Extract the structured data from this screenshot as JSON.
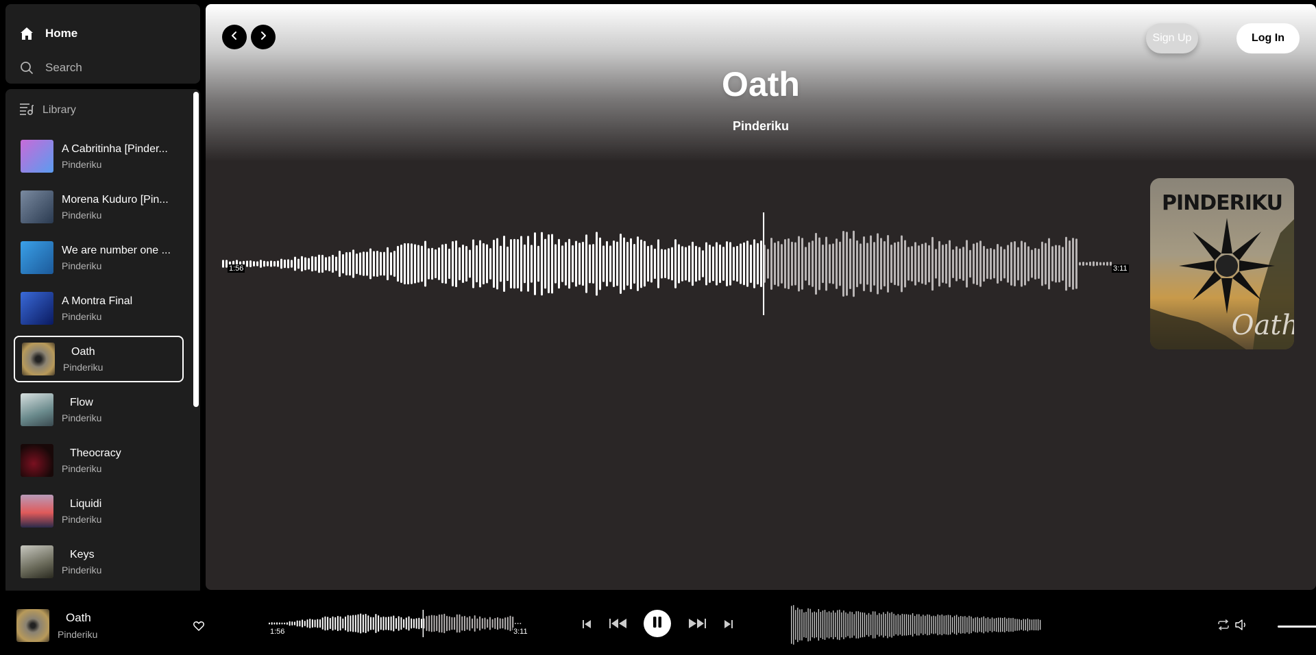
{
  "nav": {
    "home": "Home",
    "search": "Search"
  },
  "library": {
    "label": "Library",
    "tracks": [
      {
        "title": "A Cabritinha [Pinder...",
        "artist": "Pinderiku",
        "active": false
      },
      {
        "title": "Morena Kuduro [Pin...",
        "artist": "Pinderiku",
        "active": false
      },
      {
        "title": "We are number one ...",
        "artist": "Pinderiku",
        "active": false
      },
      {
        "title": "A Montra Final",
        "artist": "Pinderiku",
        "active": false
      },
      {
        "title": "Oath",
        "artist": "Pinderiku",
        "active": true
      },
      {
        "title": "Flow",
        "artist": "Pinderiku",
        "active": false
      },
      {
        "title": "Theocracy",
        "artist": "Pinderiku",
        "active": false
      },
      {
        "title": "Liquidi",
        "artist": "Pinderiku",
        "active": false
      },
      {
        "title": "Keys",
        "artist": "Pinderiku",
        "active": false
      }
    ]
  },
  "header": {
    "signup": "Sign Up",
    "login": "Log In"
  },
  "now": {
    "title": "Oath",
    "artist": "Pinderiku",
    "elapsed": "1:56",
    "duration": "3:11",
    "progress": 0.607
  },
  "cover": {
    "band": "PINDERIKU",
    "album": "Oath"
  },
  "player": {
    "title": "Oath",
    "artist": "Pinderiku",
    "elapsed": "1:56",
    "duration": "3:11",
    "volume": 1.0
  }
}
